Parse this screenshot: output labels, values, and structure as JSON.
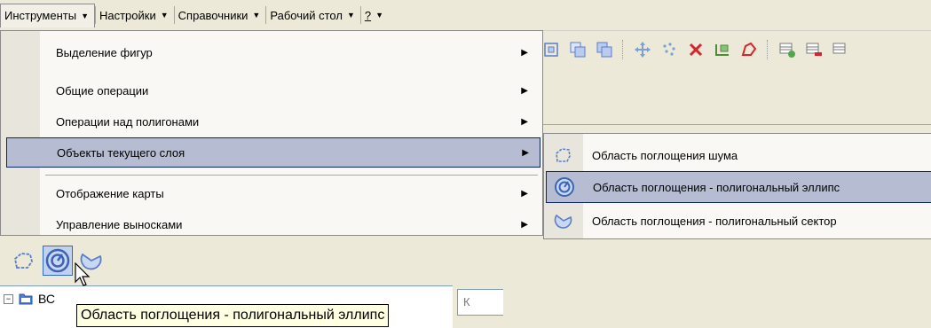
{
  "menubar": {
    "items": [
      {
        "label": "Инструменты"
      },
      {
        "label": "Настройки"
      },
      {
        "label": "Справочники"
      },
      {
        "label": "Рабочий стол"
      },
      {
        "label": "?"
      }
    ]
  },
  "menu": {
    "items": [
      {
        "label": "Выделение фигур",
        "has_submenu": true
      },
      {
        "label": "Общие операции",
        "has_submenu": true
      },
      {
        "label": "Операции над полигонами",
        "has_submenu": true
      },
      {
        "label": "Объекты текущего слоя",
        "has_submenu": true,
        "highlighted": true
      },
      {
        "label": "Отображение карты",
        "has_submenu": true
      },
      {
        "label": "Управление выносками",
        "has_submenu": true
      }
    ]
  },
  "submenu": {
    "items": [
      {
        "label": "Область поглощения шума",
        "icon": "noise-region-icon"
      },
      {
        "label": "Область поглощения - полигональный эллипс",
        "icon": "polygon-ellipse-icon",
        "highlighted": true
      },
      {
        "label": "Область поглощения - полигональный сектор",
        "icon": "polygon-sector-icon"
      }
    ]
  },
  "tree": {
    "root_label": "ВС",
    "side_field_text": "К"
  },
  "tooltip": {
    "text": "Область поглощения - полигональный эллипс"
  },
  "colors": {
    "highlight_bg": "#b6bdd2",
    "highlight_border": "#0a246a",
    "tooltip_bg": "#ffffe1",
    "chrome": "#ece9d8"
  }
}
